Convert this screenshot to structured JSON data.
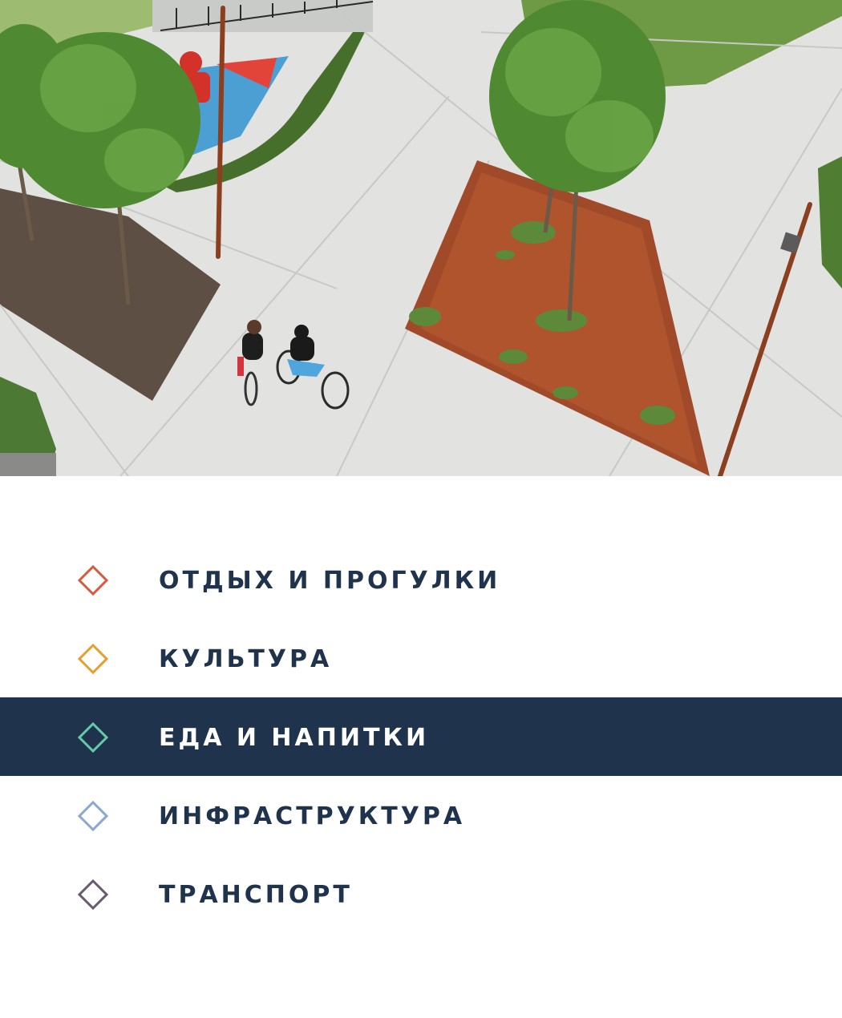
{
  "hero": {
    "image": "aerial-plaza-photo"
  },
  "colors": {
    "text_dark": "#1f344c",
    "active_bg": "#1f344c",
    "active_text": "#ffffff"
  },
  "menu": {
    "items": [
      {
        "label": "ОТДЫХ И ПРОГУЛКИ",
        "icon": "diamond-outline-icon",
        "color": "#d25b40",
        "active": false
      },
      {
        "label": "КУЛЬТУРА",
        "icon": "diamond-outline-icon",
        "color": "#e3a030",
        "active": false
      },
      {
        "label": "ЕДА И НАПИТКИ",
        "icon": "diamond-outline-icon",
        "color": "#66c9a8",
        "active": true
      },
      {
        "label": "ИНФРАСТРУКТУРА",
        "icon": "diamond-outline-icon",
        "color": "#8ca7cf",
        "active": false
      },
      {
        "label": "ТРАНСПОРТ",
        "icon": "diamond-outline-icon",
        "color": "#6a5a70",
        "active": false
      }
    ]
  }
}
